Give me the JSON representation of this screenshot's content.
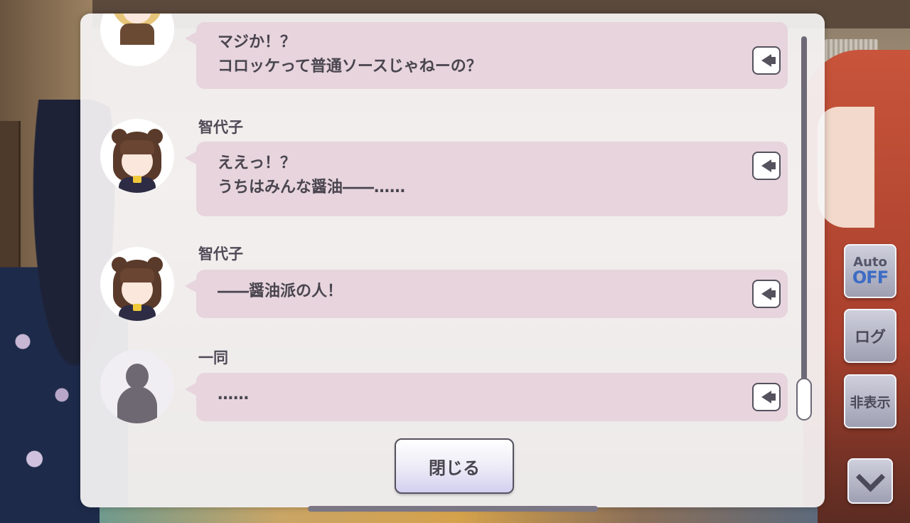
{
  "side_controls": {
    "auto_label": "Auto",
    "auto_state": "OFF",
    "log_label": "ログ",
    "hide_label": "非表示",
    "down_icon": "chevron-down-icon"
  },
  "log": {
    "entries": [
      {
        "speaker": "",
        "lines": [
          "マジか！？",
          "コロッケって普通ソースじゃねーの？"
        ]
      },
      {
        "speaker": "智代子",
        "lines": [
          "ええっ！？",
          "うちはみんな醤油――……"
        ]
      },
      {
        "speaker": "智代子",
        "lines": [
          "――醤油派の人！"
        ]
      },
      {
        "speaker": "一同",
        "lines": [
          "……"
        ]
      }
    ],
    "close_label": "閉じる"
  },
  "colors": {
    "bubble": "#e7d4dd",
    "auto_off": "#3d6cc4",
    "text": "#49454f"
  }
}
